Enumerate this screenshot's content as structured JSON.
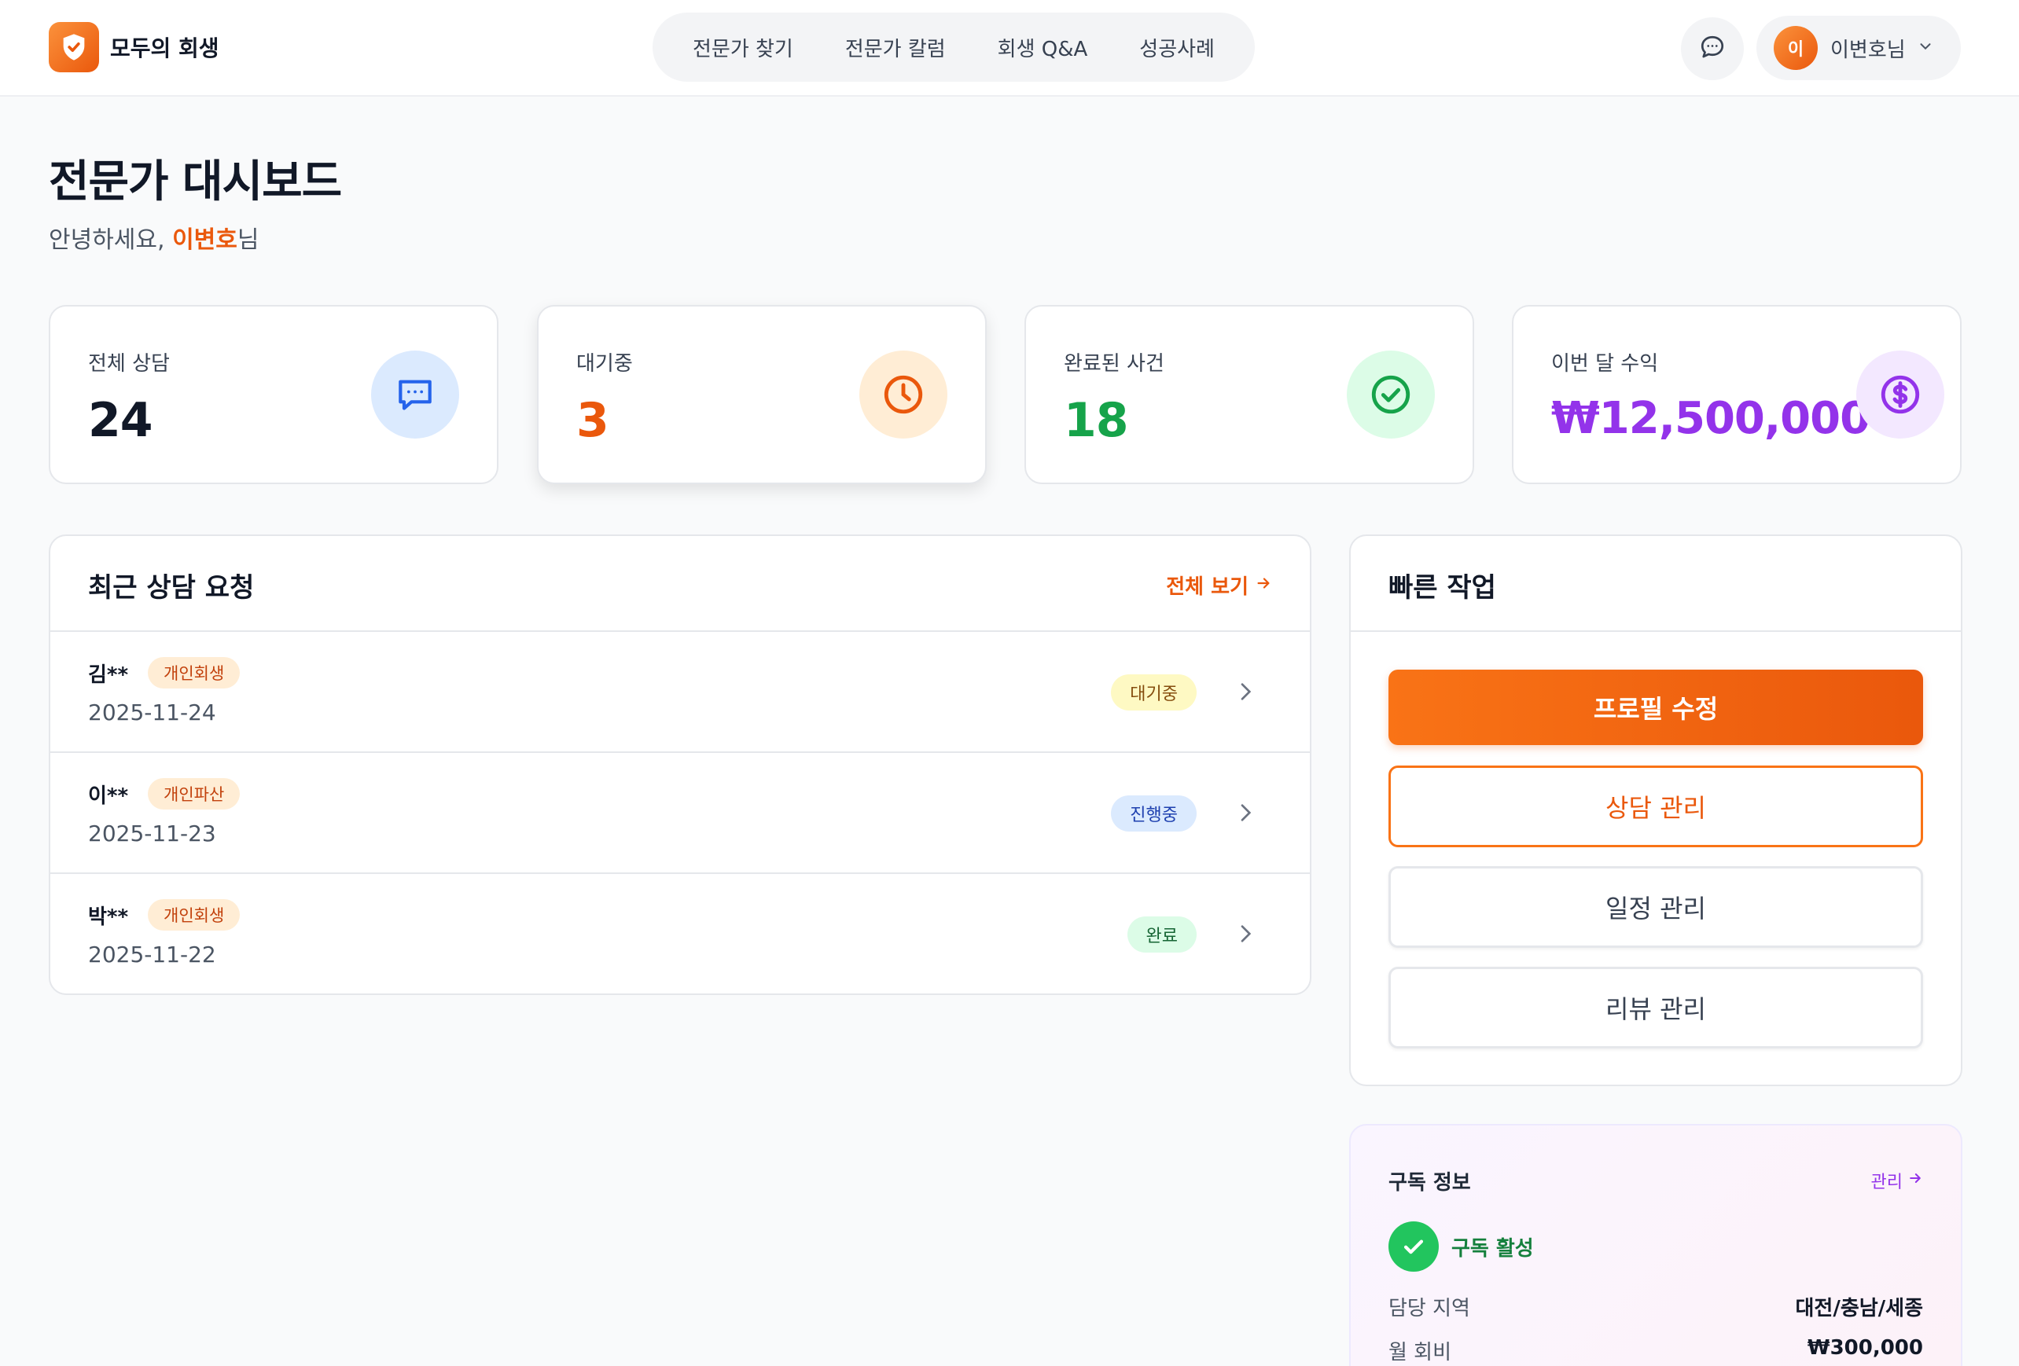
{
  "header": {
    "brand": "모두의 회생",
    "nav": [
      "전문가 찾기",
      "전문가 칼럼",
      "회생 Q&A",
      "성공사례"
    ],
    "user_initial": "이",
    "user_name": "이변호님"
  },
  "page": {
    "title": "전문가 대시보드",
    "greeting_prefix": "안녕하세요, ",
    "greeting_name": "이변호",
    "greeting_suffix": "님"
  },
  "stats": [
    {
      "label": "전체 상담",
      "value": "24",
      "color": "#111827",
      "icon": "chat-icon",
      "icon_bg": "#dbeafe",
      "icon_color": "#2563eb"
    },
    {
      "label": "대기중",
      "value": "3",
      "color": "#ea580c",
      "icon": "clock-icon",
      "icon_bg": "#ffedd5",
      "icon_color": "#ea580c"
    },
    {
      "label": "완료된 사건",
      "value": "18",
      "color": "#16a34a",
      "icon": "check-circle-icon",
      "icon_bg": "#dcfce7",
      "icon_color": "#16a34a"
    },
    {
      "label": "이번 달 수익",
      "value": "₩12,500,000",
      "color": "#9333ea",
      "icon": "dollar-icon",
      "icon_bg": "#f3e8ff",
      "icon_color": "#9333ea"
    }
  ],
  "recent": {
    "title": "최근 상담 요청",
    "view_all": "전체 보기",
    "rows": [
      {
        "name": "김**",
        "type": "개인회생",
        "date": "2025-11-24",
        "status": "대기중",
        "status_bg": "#fef9c3",
        "status_color": "#854d0e"
      },
      {
        "name": "이**",
        "type": "개인파산",
        "date": "2025-11-23",
        "status": "진행중",
        "status_bg": "#dbeafe",
        "status_color": "#1e40af"
      },
      {
        "name": "박**",
        "type": "개인회생",
        "date": "2025-11-22",
        "status": "완료",
        "status_bg": "#dcfce7",
        "status_color": "#166534"
      }
    ]
  },
  "quick": {
    "title": "빠른 작업",
    "buttons": [
      "프로필 수정",
      "상담 관리",
      "일정 관리",
      "리뷰 관리"
    ]
  },
  "subscription": {
    "title": "구독 정보",
    "manage": "관리",
    "status": "구독 활성",
    "region_label": "담당 지역",
    "region_value": "대전/충남/세종",
    "fee_label": "월 회비",
    "fee_value": "₩300,000"
  },
  "colors": {
    "accent": "#ea580c",
    "purple": "#9333ea",
    "green": "#16a34a"
  }
}
